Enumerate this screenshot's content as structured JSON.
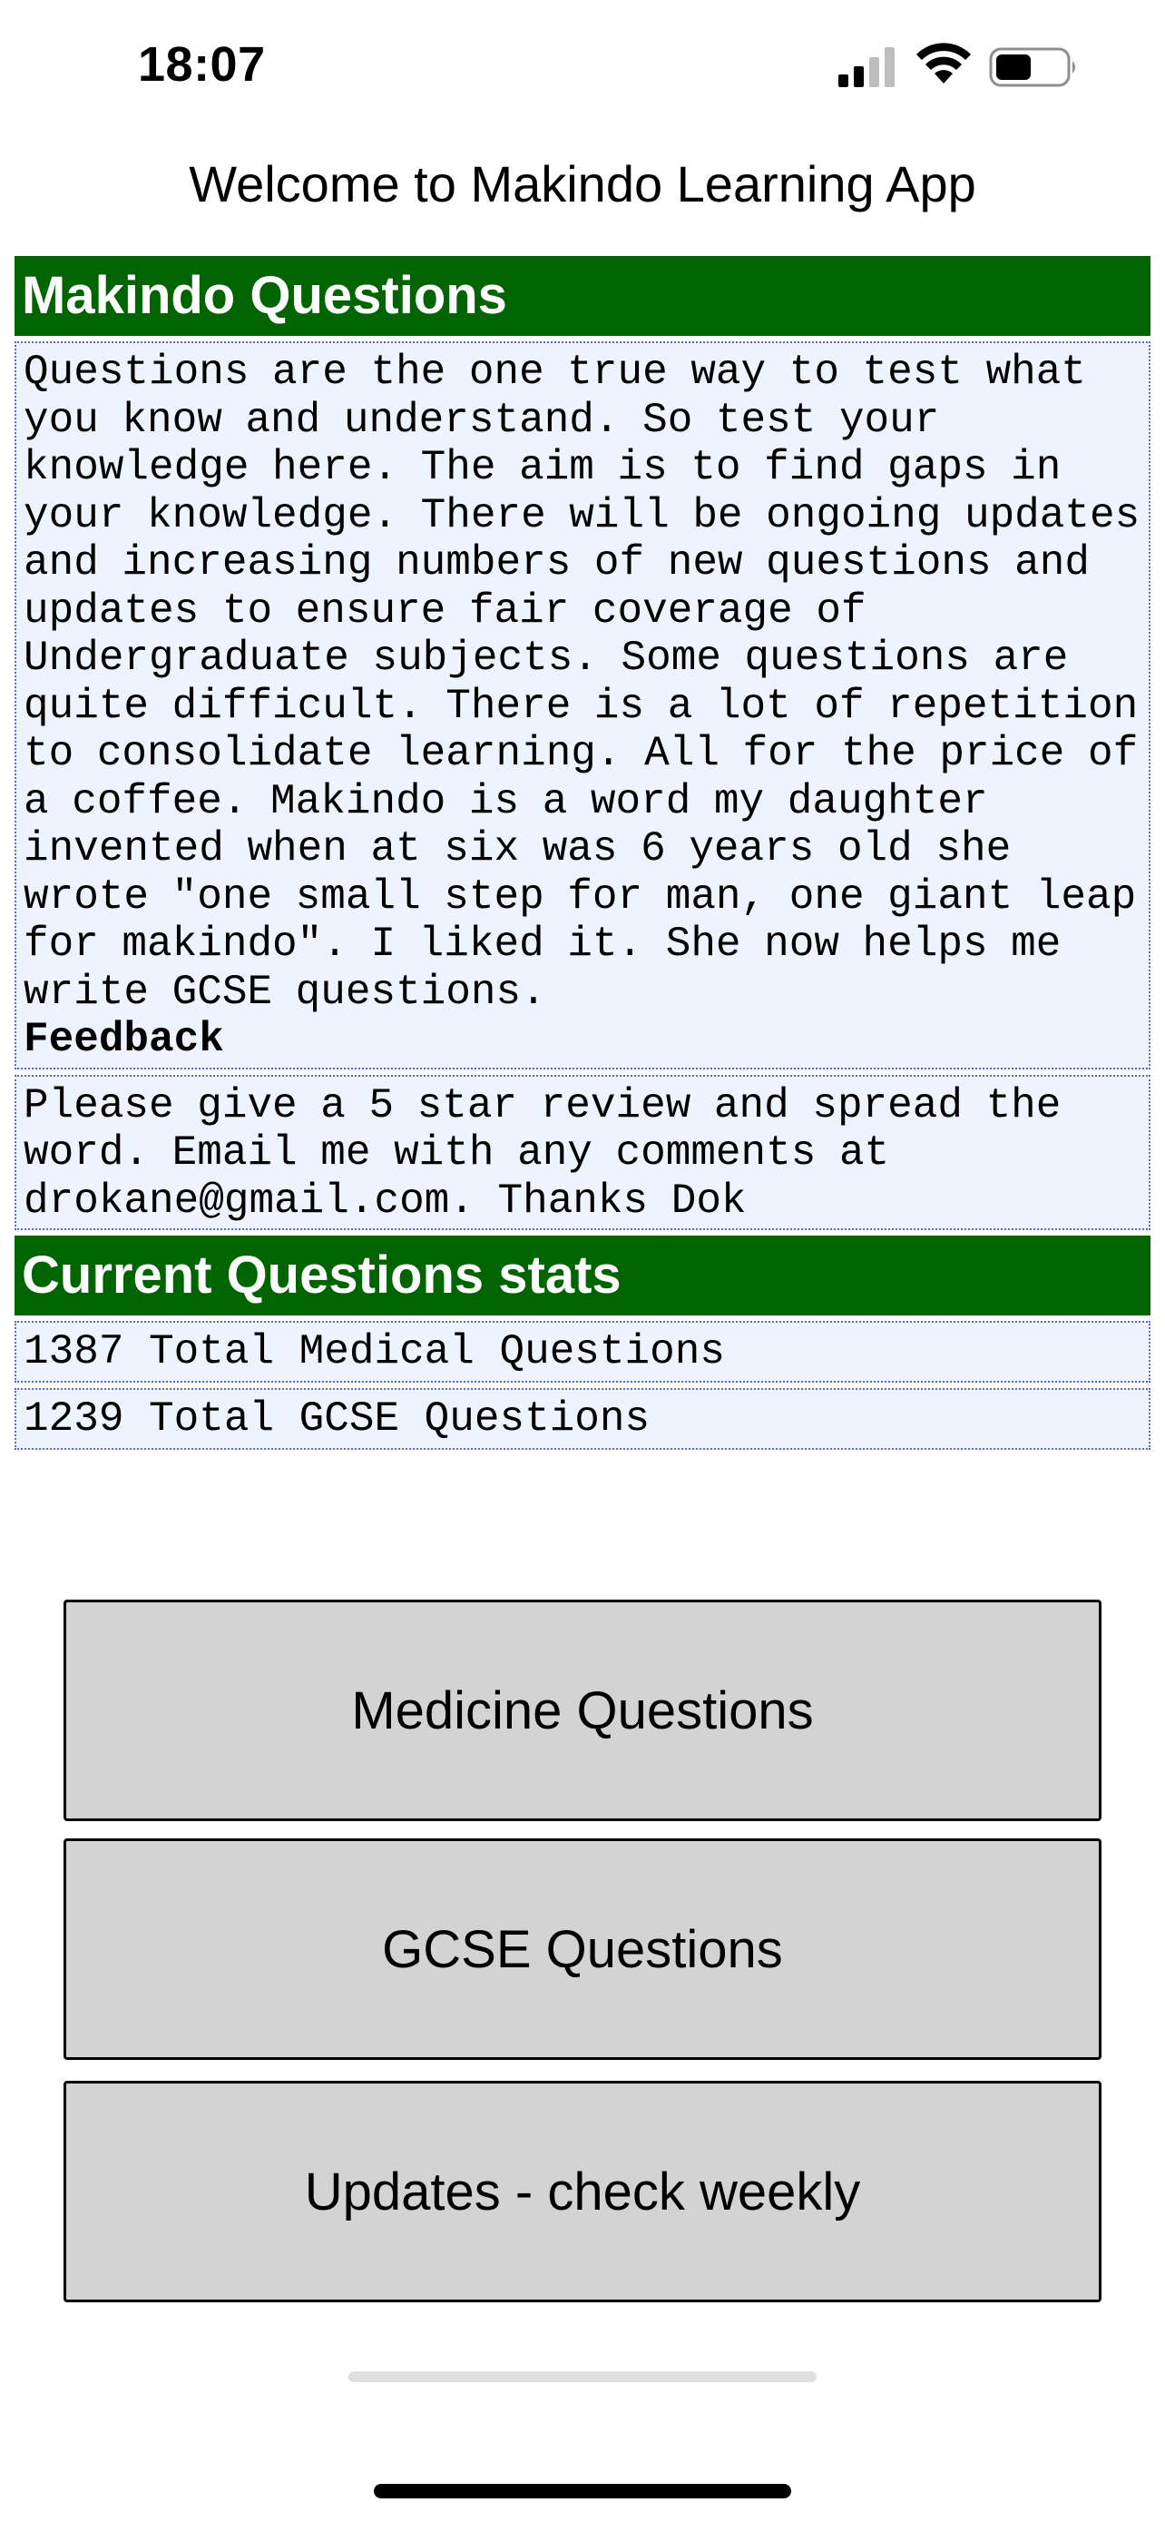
{
  "status_bar": {
    "time": "18:07"
  },
  "header": {
    "title": "Welcome to Makindo Learning App"
  },
  "sections": {
    "questions_title": "Makindo Questions",
    "intro_text": "Questions are the one true way to test what you know and understand. So test your knowledge here. The aim is to find gaps in your knowledge. There will be ongoing updates and increasing numbers of new questions and updates to ensure fair coverage of Undergraduate subjects. Some questions are quite difficult. There is a lot of repetition to consolidate learning. All for the price of a coffee. Makindo is a word my daughter invented when at six was 6 years old she wrote \"one small step for man, one giant leap for makindo\". I liked it. She now helps me write GCSE questions.",
    "feedback_label": "Feedback",
    "feedback_text": "Please give a 5 star review and spread the word. Email me with any comments at drokane@gmail.com. Thanks Dok",
    "stats_title": "Current Questions stats",
    "stats": [
      "1387 Total Medical Questions",
      "1239 Total GCSE Questions"
    ]
  },
  "buttons": {
    "medicine": "Medicine Questions",
    "gcse": "GCSE Questions",
    "updates": "Updates - check weekly"
  },
  "colors": {
    "header_green": "#006400",
    "box_background": "#eef4ff",
    "box_border": "#5b6bd6",
    "button_gray": "#d3d3d3"
  },
  "icons": {
    "signal": "cellular-signal-icon",
    "wifi": "wifi-icon",
    "battery": "battery-icon"
  }
}
